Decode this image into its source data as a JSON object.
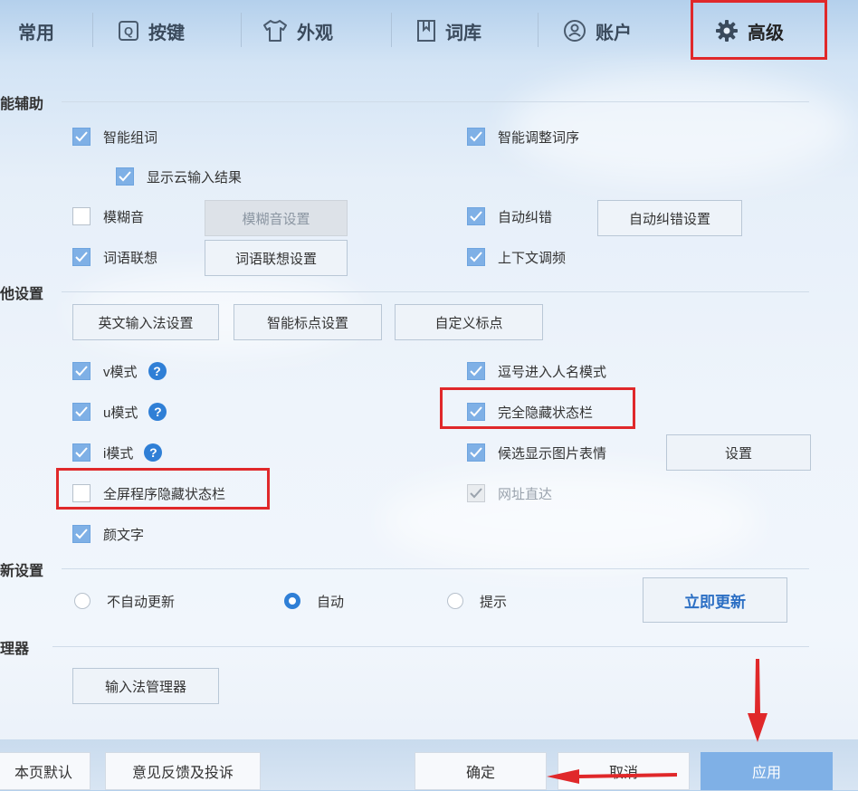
{
  "tabs": [
    {
      "label": "常用",
      "icon": "none"
    },
    {
      "label": "按键",
      "icon": "key-icon"
    },
    {
      "label": "外观",
      "icon": "shirt-icon"
    },
    {
      "label": "词库",
      "icon": "book-icon"
    },
    {
      "label": "账户",
      "icon": "user-icon"
    },
    {
      "label": "高级",
      "icon": "gear-icon",
      "active": true
    }
  ],
  "sections": {
    "smart": {
      "title": "能辅助"
    },
    "other": {
      "title": "他设置"
    },
    "update": {
      "title": "新设置"
    },
    "manager": {
      "title": "理器"
    }
  },
  "smart": {
    "smart_phrase": {
      "label": "智能组词",
      "checked": true
    },
    "smart_order": {
      "label": "智能调整词序",
      "checked": true
    },
    "cloud_result": {
      "label": "显示云输入结果",
      "checked": true
    },
    "fuzzy": {
      "label": "模糊音",
      "checked": false
    },
    "fuzzy_btn": "模糊音设置",
    "autocorrect": {
      "label": "自动纠错",
      "checked": true
    },
    "autocorrect_btn": "自动纠错设置",
    "association": {
      "label": "词语联想",
      "checked": true
    },
    "association_btn": "词语联想设置",
    "context": {
      "label": "上下文调频",
      "checked": true
    }
  },
  "other": {
    "btn_english": "英文输入法设置",
    "btn_punct": "智能标点设置",
    "btn_custom_punct": "自定义标点",
    "v_mode": {
      "label": "v模式",
      "checked": true
    },
    "u_mode": {
      "label": "u模式",
      "checked": true
    },
    "i_mode": {
      "label": "i模式",
      "checked": true
    },
    "help_glyph": "?",
    "comma_name": {
      "label": "逗号进入人名模式",
      "checked": true
    },
    "hide_status": {
      "label": "完全隐藏状态栏",
      "checked": true
    },
    "emoji_pic": {
      "label": "候选显示图片表情",
      "checked": true
    },
    "emoji_btn": "设置",
    "fullscreen_hide": {
      "label": "全屏程序隐藏状态栏",
      "checked": false
    },
    "url_direct": {
      "label": "网址直达",
      "checked": true,
      "disabled": true
    },
    "kaomoji": {
      "label": "颜文字",
      "checked": true
    }
  },
  "update": {
    "options": [
      "不自动更新",
      "自动",
      "提示"
    ],
    "selected": "自动",
    "update_now": "立即更新"
  },
  "manager": {
    "button": "输入法管理器"
  },
  "footer": {
    "restore": "本页默认",
    "feedback": "意见反馈及投诉",
    "ok": "确定",
    "cancel": "取消",
    "apply": "应用"
  },
  "colors": {
    "accent": "#2f7fd6",
    "checkbox_on": "#7fb0e6",
    "annotation": "#e0282a",
    "apply_bg": "#7fb0e6"
  }
}
